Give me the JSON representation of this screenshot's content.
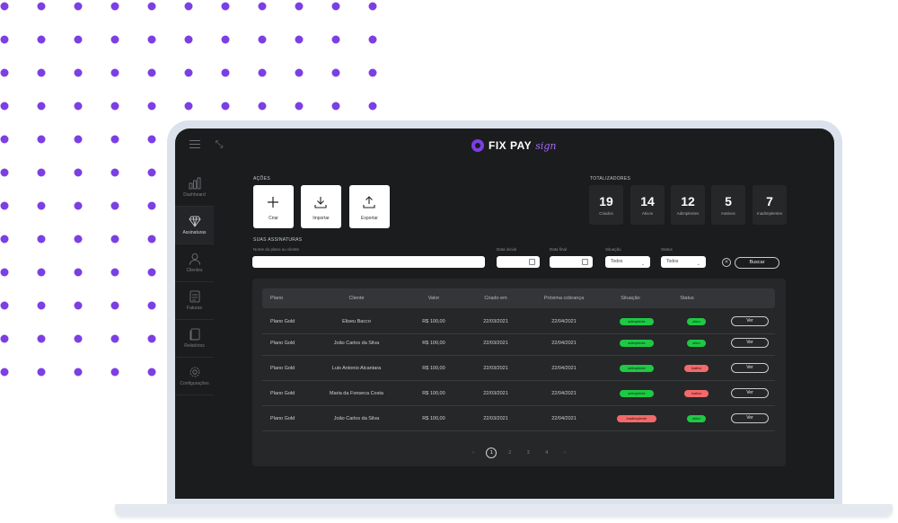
{
  "app": {
    "logo_text": "FIX PAY",
    "logo_script": "sign"
  },
  "colors": {
    "accent": "#7b3fe4",
    "success": "#1ec944",
    "danger": "#f26a6a",
    "screen_bg": "#1b1c1e"
  },
  "sidebar": {
    "items": [
      {
        "label": "Dashboard",
        "icon": "bar-chart-icon",
        "active": false
      },
      {
        "label": "Assinaturas",
        "icon": "diamond-icon",
        "active": true
      },
      {
        "label": "Clientes",
        "icon": "user-icon",
        "active": false
      },
      {
        "label": "Faturas",
        "icon": "invoice-icon",
        "active": false
      },
      {
        "label": "Relatórios",
        "icon": "report-icon",
        "active": false
      },
      {
        "label": "Configurações",
        "icon": "gear-icon",
        "active": false
      }
    ]
  },
  "actions": {
    "section_label": "AÇÕES",
    "items": [
      {
        "label": "Criar",
        "icon": "plus-icon"
      },
      {
        "label": "Importar",
        "icon": "download-icon"
      },
      {
        "label": "Exportar",
        "icon": "upload-icon"
      }
    ]
  },
  "totals": {
    "section_label": "TOTALIZADORES",
    "items": [
      {
        "value": "19",
        "label": "Criados"
      },
      {
        "value": "14",
        "label": "Ativos"
      },
      {
        "value": "12",
        "label": "Adimplentes"
      },
      {
        "value": "5",
        "label": "Inativos"
      },
      {
        "value": "7",
        "label": "Inadimplentes"
      }
    ]
  },
  "filters": {
    "section_label": "SUAS ASSINATURAS",
    "search_label": "Nome do plano ou cliente",
    "search_value": "",
    "date_start_label": "Data inicial",
    "date_end_label": "Data final",
    "situation_label": "Situação",
    "situation_value": "Todos",
    "status_label": "Status",
    "status_value": "Todos",
    "search_button": "Buscar"
  },
  "table": {
    "headers": [
      "Plano",
      "Cliente",
      "Valor",
      "Criado em",
      "Próxima cobrança",
      "Situação",
      "Status"
    ],
    "rows": [
      {
        "plano": "Plano Gold",
        "cliente": "Eliseu Bacco",
        "valor": "R$ 100,00",
        "criado": "22/03/2021",
        "proxima": "22/04/2021",
        "situacao": "adimplente",
        "situacao_tone": "green",
        "status": "ativo",
        "status_tone": "green",
        "acao": "Ver"
      },
      {
        "plano": "Plano Gold",
        "cliente": "João Carlos da Silva",
        "valor": "R$ 100,00",
        "criado": "22/03/2021",
        "proxima": "22/04/2021",
        "situacao": "adimplente",
        "situacao_tone": "green",
        "status": "ativo",
        "status_tone": "green",
        "acao": "Ver"
      },
      {
        "plano": "Plano Gold",
        "cliente": "Luis Antonio Alcantara",
        "valor": "R$ 100,00",
        "criado": "22/03/2021",
        "proxima": "22/04/2021",
        "situacao": "adimplente",
        "situacao_tone": "green",
        "status": "inativo",
        "status_tone": "red",
        "acao": "Ver"
      },
      {
        "plano": "Plano Gold",
        "cliente": "Maria da Fonseca Costa",
        "valor": "R$ 100,00",
        "criado": "22/03/2021",
        "proxima": "22/04/2021",
        "situacao": "adimplente",
        "situacao_tone": "green",
        "status": "inativo",
        "status_tone": "red",
        "acao": "Ver"
      },
      {
        "plano": "Plano Gold",
        "cliente": "João Carlos da Silva",
        "valor": "R$ 100,00",
        "criado": "22/03/2021",
        "proxima": "22/04/2021",
        "situacao": "inadimplente",
        "situacao_tone": "red",
        "status": "ativo",
        "status_tone": "green",
        "acao": "Ver"
      }
    ]
  },
  "pagination": {
    "prev": "‹",
    "pages": [
      "1",
      "2",
      "3",
      "4"
    ],
    "current": "1",
    "next": "›"
  }
}
